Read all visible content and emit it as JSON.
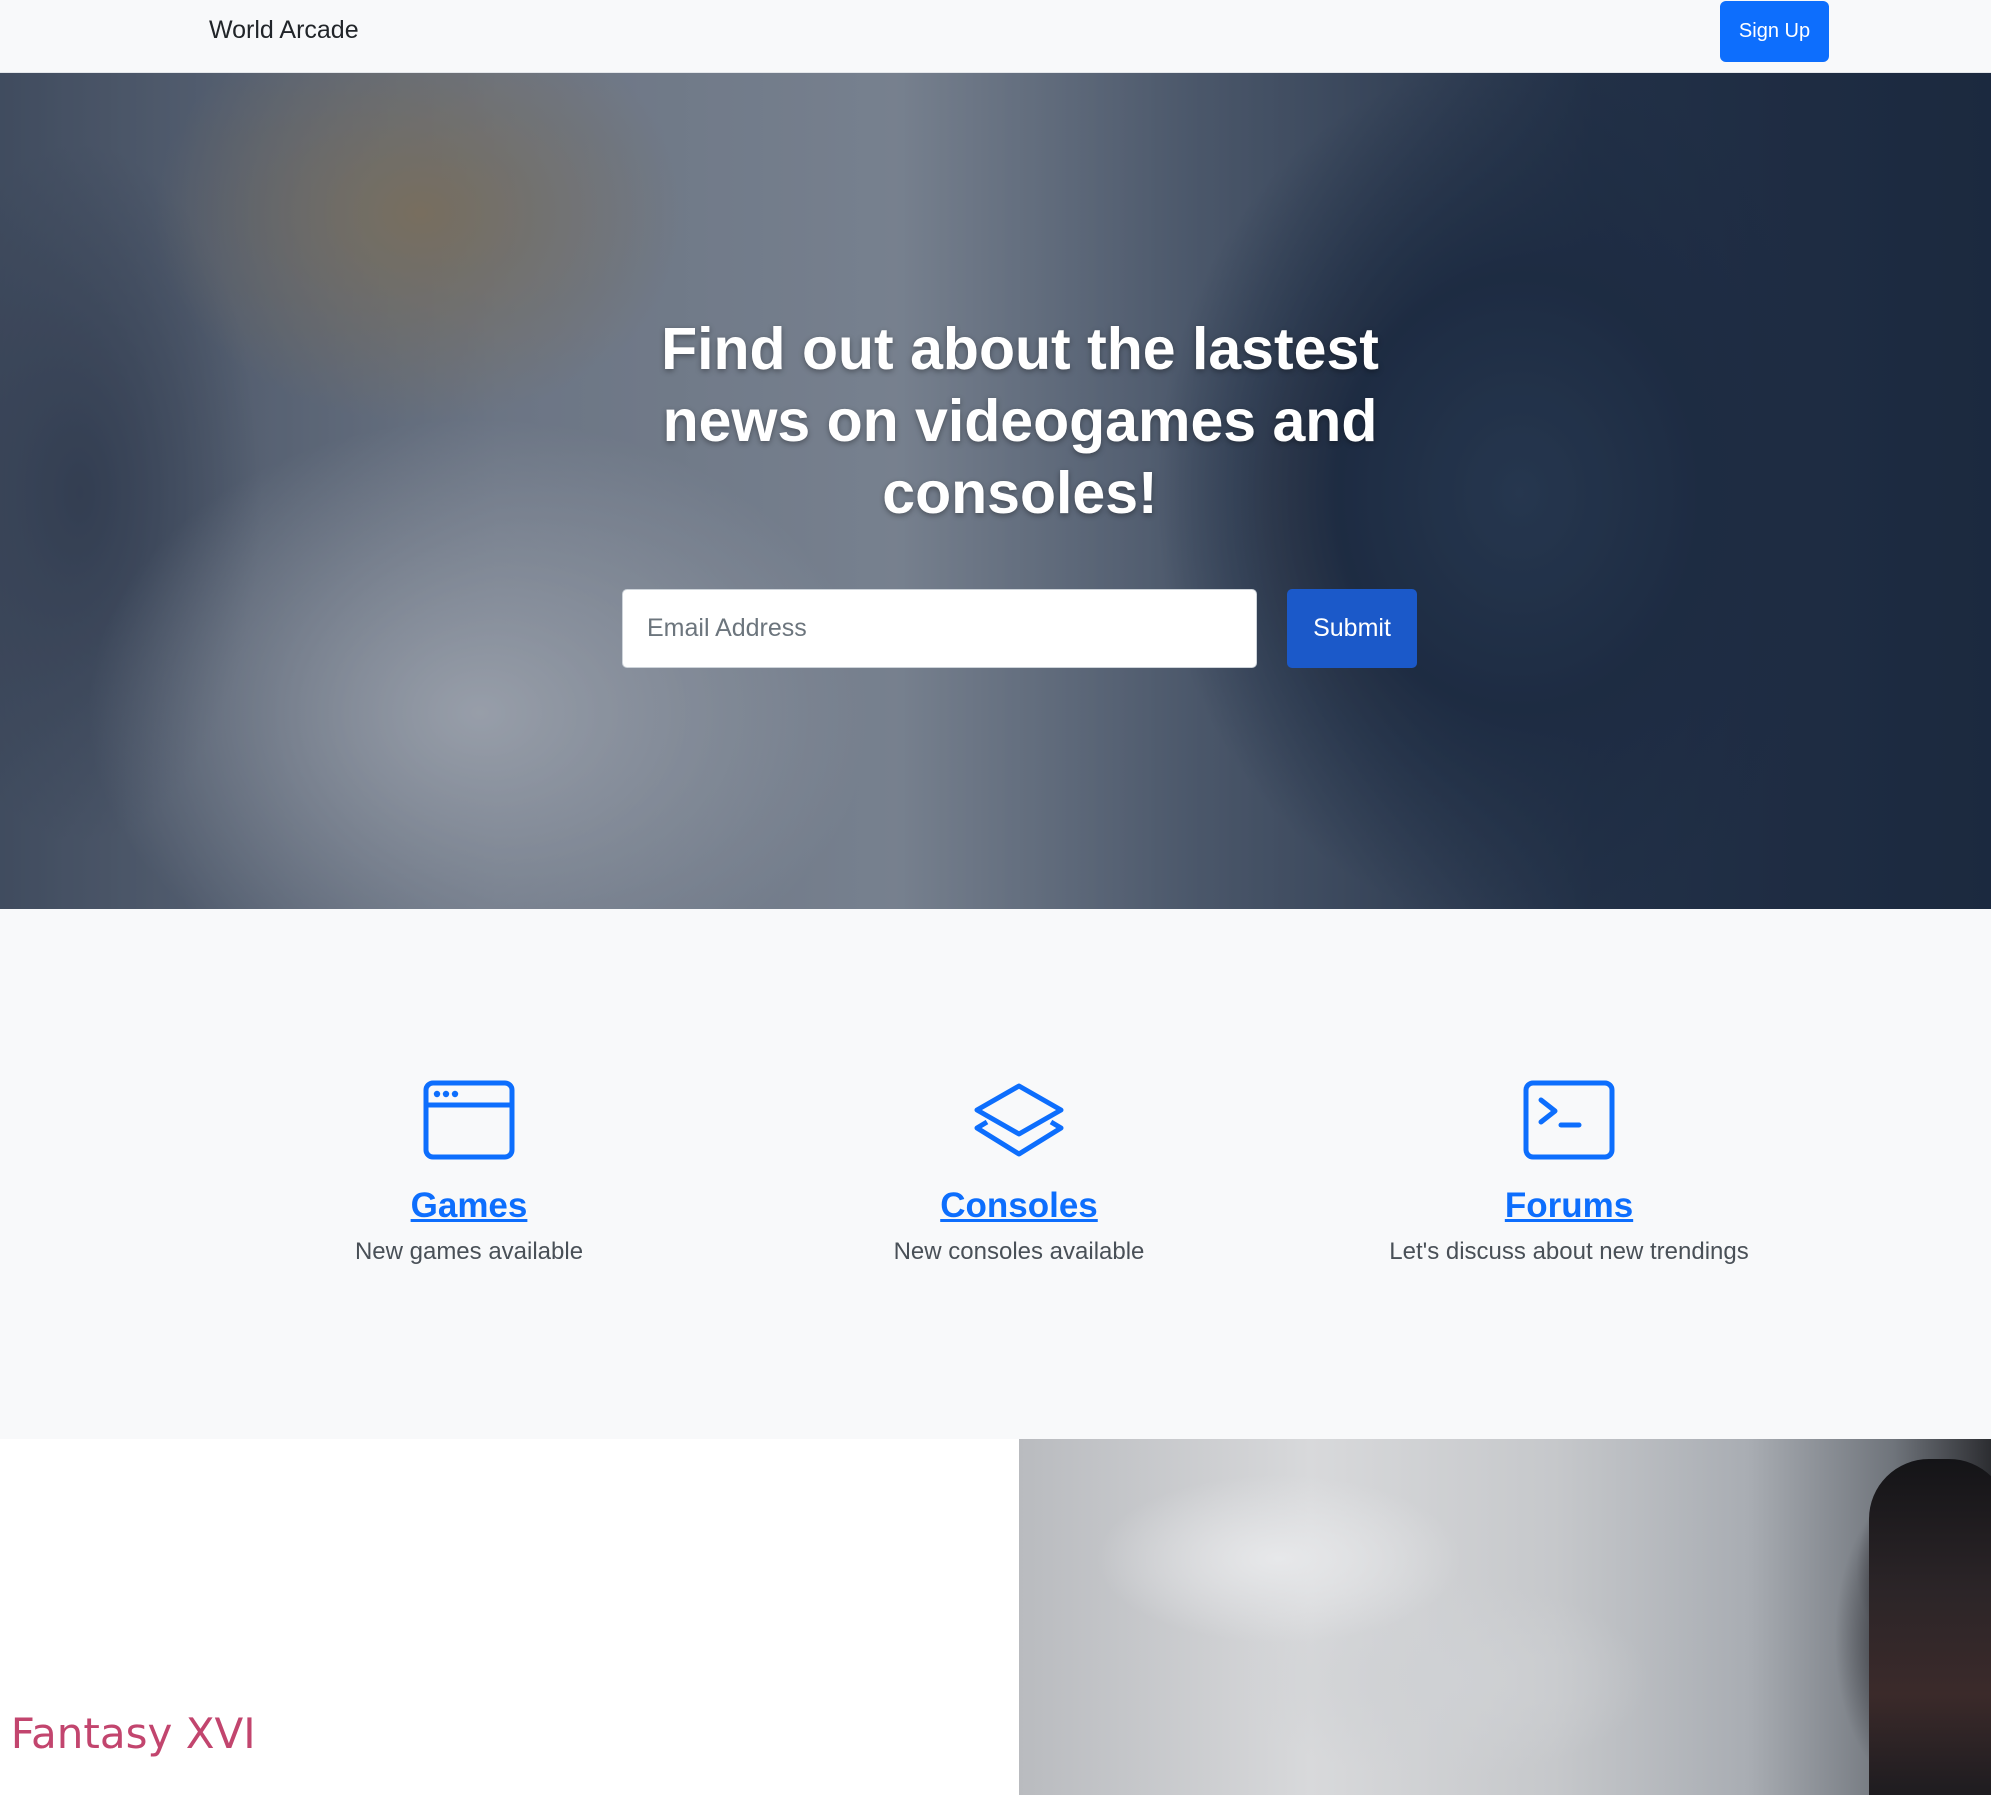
{
  "navbar": {
    "brand": "World Arcade",
    "signup_label": "Sign Up"
  },
  "hero": {
    "title": "Find out about the lastest news on videogames and consoles!",
    "email_placeholder": "Email Address",
    "submit_label": "Submit"
  },
  "features": [
    {
      "icon": "browser-window-icon",
      "title": "Games",
      "text": "New games available"
    },
    {
      "icon": "layers-icon",
      "title": "Consoles",
      "text": "New consoles available"
    },
    {
      "icon": "terminal-icon",
      "title": "Forums",
      "text": "Let's discuss about new trendings"
    }
  ],
  "showcase": {
    "heading": "al Fantasy XVI"
  },
  "colors": {
    "accent": "#0d6efd",
    "submit": "#1b59c9",
    "showcase_heading": "#c2456e"
  }
}
